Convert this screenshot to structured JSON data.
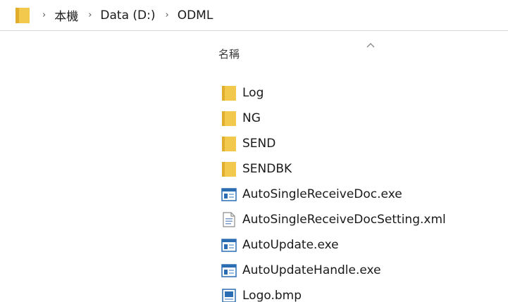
{
  "breadcrumb": {
    "separator": "›",
    "items": [
      "本機",
      "Data (D:)",
      "ODML"
    ]
  },
  "columns": {
    "name_header": "名稱"
  },
  "colors": {
    "folder": "#f2c94c",
    "folder_dark": "#e0ad2c",
    "exe_blue": "#2a6db3"
  },
  "files": [
    {
      "name": "Log",
      "icon": "folder-icon"
    },
    {
      "name": "NG",
      "icon": "folder-icon"
    },
    {
      "name": "SEND",
      "icon": "folder-icon"
    },
    {
      "name": "SENDBK",
      "icon": "folder-icon"
    },
    {
      "name": "AutoSingleReceiveDoc.exe",
      "icon": "exe-icon"
    },
    {
      "name": "AutoSingleReceiveDocSetting.xml",
      "icon": "xml-file-icon"
    },
    {
      "name": "AutoUpdate.exe",
      "icon": "exe-icon"
    },
    {
      "name": "AutoUpdateHandle.exe",
      "icon": "exe-icon"
    },
    {
      "name": "Logo.bmp",
      "icon": "image-file-icon"
    }
  ]
}
